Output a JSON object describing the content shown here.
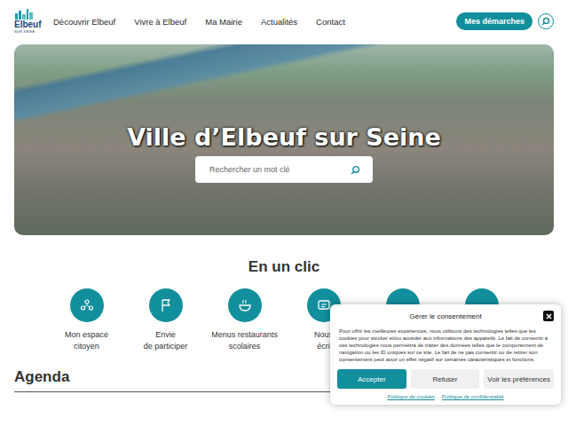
{
  "header": {
    "logo": {
      "name": "Elbeuf",
      "tagline": "SUR-SEINE"
    },
    "nav": [
      "Découvrir Elbeuf",
      "Vivre à Elbeuf",
      "Ma Mairie",
      "Actualités",
      "Contact"
    ],
    "cta": "Mes démarches"
  },
  "hero": {
    "title": "Ville d’Elbeuf sur Seine",
    "search": {
      "placeholder": "Rechercher un mot clé"
    }
  },
  "quick_links": {
    "title": "En un clic",
    "items": [
      {
        "kind": "people",
        "lines": [
          "Mon espace",
          "citoyen"
        ]
      },
      {
        "kind": "flag",
        "lines": [
          "Envie",
          "de participer"
        ]
      },
      {
        "kind": "food",
        "lines": [
          "Menus restaurants",
          "scolaires"
        ]
      },
      {
        "kind": "mail",
        "lines": [
          "Nous",
          "écri"
        ]
      },
      {
        "kind": "blank",
        "lines": []
      },
      {
        "kind": "blank",
        "lines": []
      }
    ]
  },
  "agenda": {
    "title": "Agenda"
  },
  "cookie_dialog": {
    "title": "Gérer le consentement",
    "text": "Pour offrir les meilleures expériences, nous utilisons des technologies telles que les cookies pour stocker et/ou accéder aux informations des appareils. Le fait de consentir à ces technologies nous permettra de traiter des données telles que le comportement de navigation ou les ID uniques sur ce site. Le fait de ne pas consentir ou de retirer son consentement peut avoir un effet négatif sur certaines caractéristiques et fonctions.",
    "buttons": [
      {
        "label": "Accepter",
        "primary": true
      },
      {
        "label": "Refuser",
        "primary": false
      },
      {
        "label": "Voir les préférences",
        "primary": false
      }
    ],
    "links": [
      "Politique de cookies",
      "Politique de confidentialité"
    ]
  }
}
